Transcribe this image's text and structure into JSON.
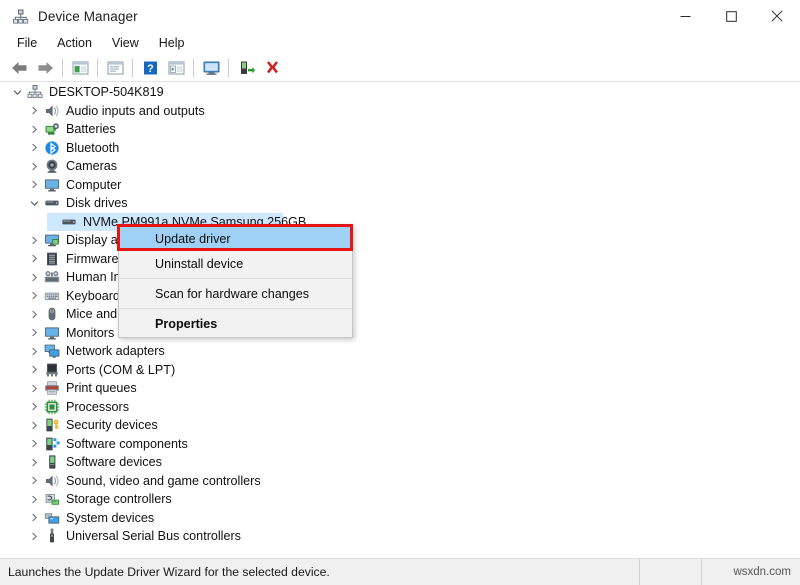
{
  "window": {
    "title": "Device Manager",
    "title_icon": "device-manager-icon",
    "minimize_label": "Minimize",
    "maximize_label": "Maximize",
    "close_label": "Close"
  },
  "menubar": {
    "items": [
      {
        "label": "File"
      },
      {
        "label": "Action"
      },
      {
        "label": "View"
      },
      {
        "label": "Help"
      }
    ]
  },
  "toolbar": {
    "buttons": [
      {
        "name": "back-icon",
        "tooltip": "Back"
      },
      {
        "name": "forward-icon",
        "tooltip": "Forward"
      },
      {
        "name": "show-hide-console-tree-icon",
        "tooltip": "Show/Hide Console Tree"
      },
      {
        "name": "properties-icon",
        "tooltip": "Properties"
      },
      {
        "name": "help-icon",
        "tooltip": "Help"
      },
      {
        "name": "update-driver-icon",
        "tooltip": "Update driver"
      },
      {
        "name": "scan-hardware-changes-icon",
        "tooltip": "Scan for hardware changes"
      },
      {
        "name": "enable-device-icon",
        "tooltip": "Enable device"
      },
      {
        "name": "uninstall-device-icon",
        "tooltip": "Uninstall device"
      }
    ]
  },
  "tree": {
    "nodes": [
      {
        "label": "DESKTOP-504K819",
        "level": 0,
        "icon": "computer-root-icon",
        "expanded": true,
        "has_children": true,
        "selected": false
      },
      {
        "label": "Audio inputs and outputs",
        "level": 1,
        "icon": "speaker-icon",
        "expanded": false,
        "has_children": true,
        "selected": false
      },
      {
        "label": "Batteries",
        "level": 1,
        "icon": "battery-icon",
        "expanded": false,
        "has_children": true,
        "selected": false
      },
      {
        "label": "Bluetooth",
        "level": 1,
        "icon": "bluetooth-icon",
        "expanded": false,
        "has_children": true,
        "selected": false
      },
      {
        "label": "Cameras",
        "level": 1,
        "icon": "camera-icon",
        "expanded": false,
        "has_children": true,
        "selected": false
      },
      {
        "label": "Computer",
        "level": 1,
        "icon": "monitor-icon",
        "expanded": false,
        "has_children": true,
        "selected": false
      },
      {
        "label": "Disk drives",
        "level": 1,
        "icon": "disk-drive-icon",
        "expanded": true,
        "has_children": true,
        "selected": false
      },
      {
        "label": "NVMe PM991a NVMe Samsung 256GB",
        "level": 2,
        "icon": "disk-drive-icon",
        "expanded": false,
        "has_children": false,
        "selected": true
      },
      {
        "label": "Display adapters",
        "level": 1,
        "icon": "display-adapter-icon",
        "expanded": false,
        "has_children": true,
        "selected": false
      },
      {
        "label": "Firmware",
        "level": 1,
        "icon": "firmware-icon",
        "expanded": false,
        "has_children": true,
        "selected": false
      },
      {
        "label": "Human Interface Devices",
        "level": 1,
        "icon": "hid-icon",
        "expanded": false,
        "has_children": true,
        "selected": false
      },
      {
        "label": "Keyboards",
        "level": 1,
        "icon": "keyboard-icon",
        "expanded": false,
        "has_children": true,
        "selected": false
      },
      {
        "label": "Mice and other pointing devices",
        "level": 1,
        "icon": "mouse-icon",
        "expanded": false,
        "has_children": true,
        "selected": false
      },
      {
        "label": "Monitors",
        "level": 1,
        "icon": "monitor-icon",
        "expanded": false,
        "has_children": true,
        "selected": false
      },
      {
        "label": "Network adapters",
        "level": 1,
        "icon": "network-adapter-icon",
        "expanded": false,
        "has_children": true,
        "selected": false
      },
      {
        "label": "Ports (COM & LPT)",
        "level": 1,
        "icon": "port-icon",
        "expanded": false,
        "has_children": true,
        "selected": false
      },
      {
        "label": "Print queues",
        "level": 1,
        "icon": "printer-icon",
        "expanded": false,
        "has_children": true,
        "selected": false
      },
      {
        "label": "Processors",
        "level": 1,
        "icon": "processor-icon",
        "expanded": false,
        "has_children": true,
        "selected": false
      },
      {
        "label": "Security devices",
        "level": 1,
        "icon": "security-device-icon",
        "expanded": false,
        "has_children": true,
        "selected": false
      },
      {
        "label": "Software components",
        "level": 1,
        "icon": "software-component-icon",
        "expanded": false,
        "has_children": true,
        "selected": false
      },
      {
        "label": "Software devices",
        "level": 1,
        "icon": "software-device-icon",
        "expanded": false,
        "has_children": true,
        "selected": false
      },
      {
        "label": "Sound, video and game controllers",
        "level": 1,
        "icon": "speaker-icon",
        "expanded": false,
        "has_children": true,
        "selected": false
      },
      {
        "label": "Storage controllers",
        "level": 1,
        "icon": "storage-controller-icon",
        "expanded": false,
        "has_children": true,
        "selected": false
      },
      {
        "label": "System devices",
        "level": 1,
        "icon": "system-device-icon",
        "expanded": false,
        "has_children": true,
        "selected": false
      },
      {
        "label": "Universal Serial Bus controllers",
        "level": 1,
        "icon": "usb-icon",
        "expanded": false,
        "has_children": true,
        "selected": false
      }
    ]
  },
  "context_menu": {
    "items": [
      {
        "label": "Update driver",
        "highlighted": true,
        "bold": false,
        "separator_after": false
      },
      {
        "label": "Uninstall device",
        "highlighted": false,
        "bold": false,
        "separator_after": true
      },
      {
        "label": "Scan for hardware changes",
        "highlighted": false,
        "bold": false,
        "separator_after": true
      },
      {
        "label": "Properties",
        "highlighted": false,
        "bold": true,
        "separator_after": false
      }
    ],
    "highlight_color": "#9fd1f7",
    "annotation_color": "#e81313"
  },
  "statusbar": {
    "message": "Launches the Update Driver Wizard for the selected device.",
    "watermark": "wsxdn.com"
  }
}
